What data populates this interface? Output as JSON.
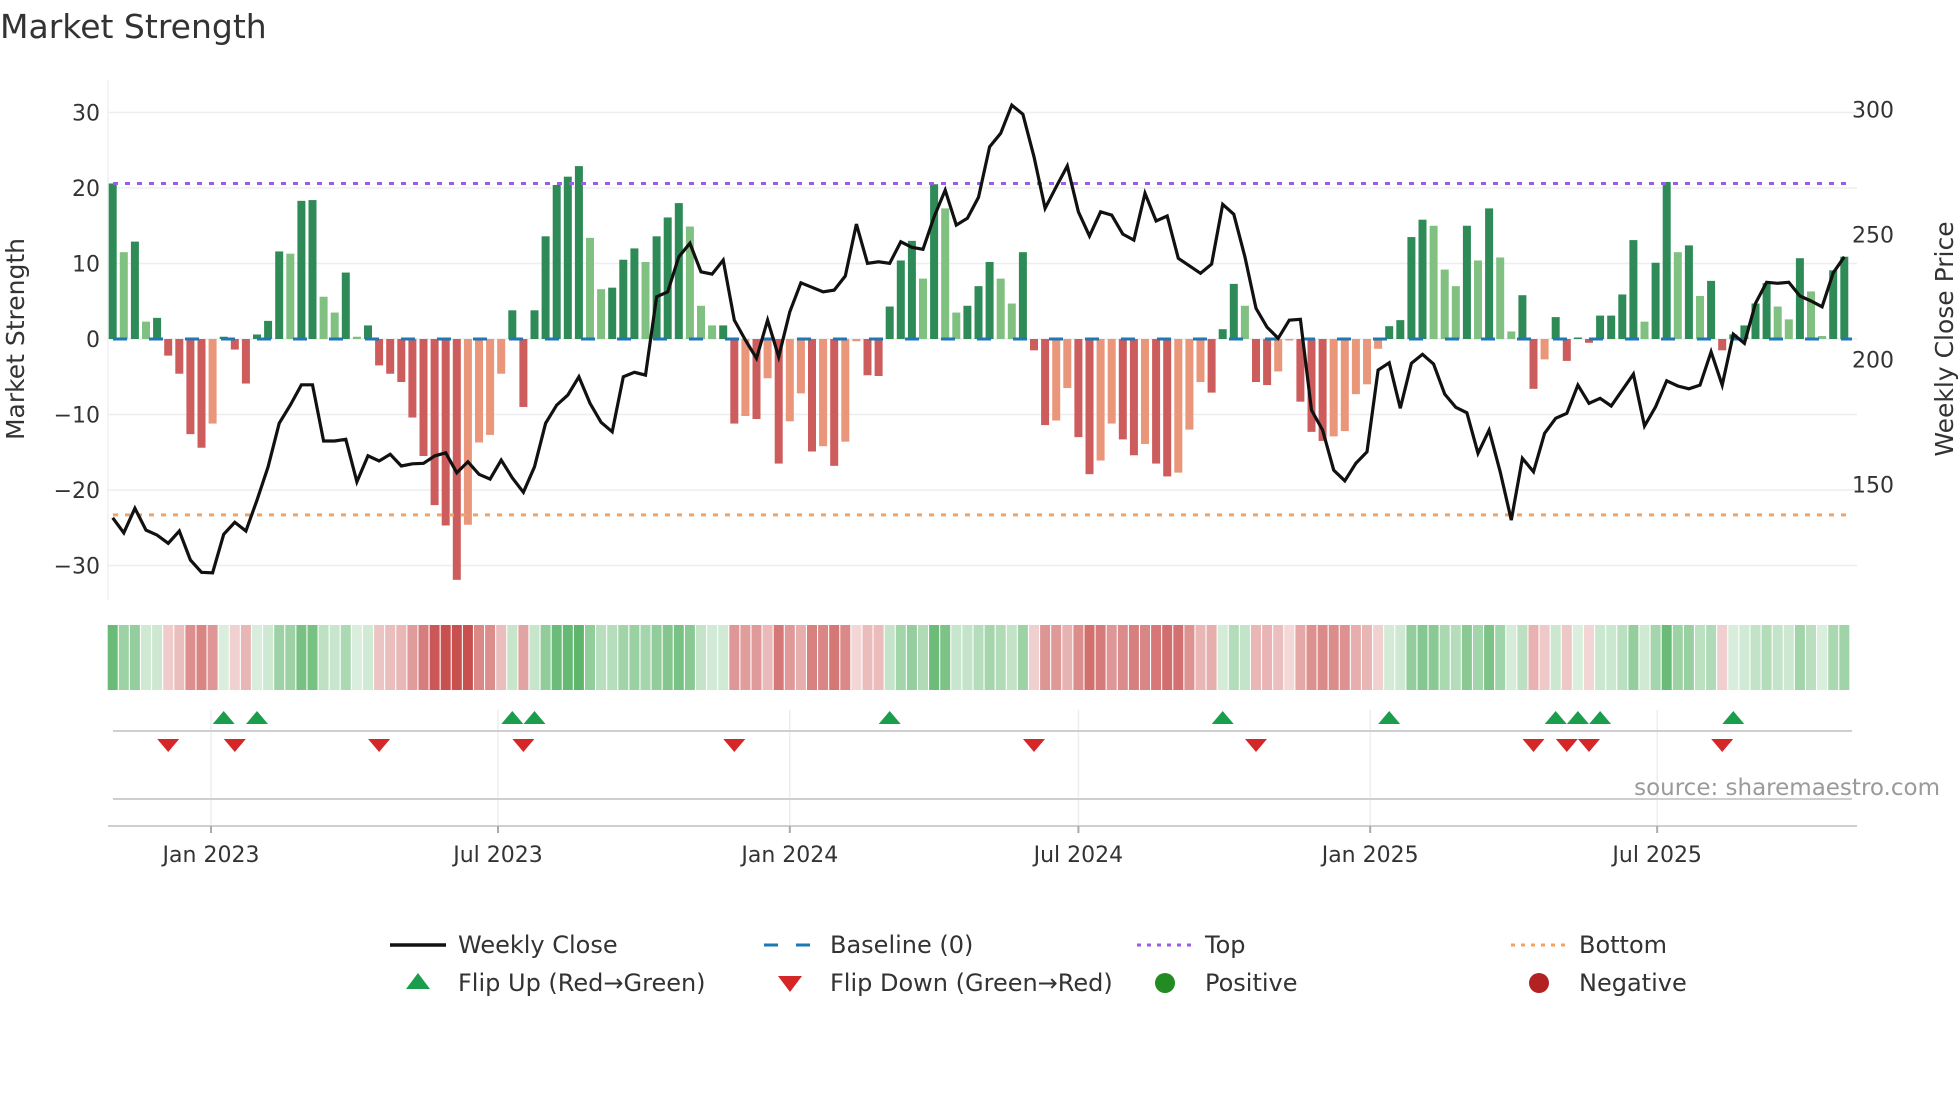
{
  "chart_data": {
    "type": "bar",
    "title": "Market Strength",
    "ylabel": "Market Strength",
    "y2label": "Weekly Close Price",
    "ylim": [
      -35,
      34
    ],
    "y2lim": [
      113,
      304
    ],
    "yticks": [
      30,
      20,
      10,
      0,
      -10,
      -20,
      -30
    ],
    "yticklabels": [
      "30",
      "20",
      "10",
      "0",
      "−10",
      "−20",
      "−30"
    ],
    "y2ticks": [
      300,
      250,
      200,
      150
    ],
    "y2ticklabels": [
      "300",
      "250",
      "200",
      "150"
    ],
    "start_week": "2022-10-31",
    "frequency": "weekly",
    "xticks": [
      {
        "date": "2023-01-01",
        "label": "Jan 2023"
      },
      {
        "date": "2023-07-01",
        "label": "Jul 2023"
      },
      {
        "date": "2024-01-01",
        "label": "Jan 2024"
      },
      {
        "date": "2024-07-01",
        "label": "Jul 2024"
      },
      {
        "date": "2025-01-01",
        "label": "Jan 2025"
      },
      {
        "date": "2025-07-01",
        "label": "Jul 2025"
      }
    ],
    "top_level": 20.6,
    "bottom_level": -23.3,
    "baseline": 0,
    "series": [
      {
        "name": "Market Strength",
        "type": "bar",
        "axis": "left",
        "values": [
          20.6,
          11.5,
          12.9,
          2.3,
          2.8,
          -2.2,
          -4.6,
          -12.6,
          -14.4,
          -11.2,
          0.3,
          -1.4,
          -5.9,
          0.6,
          2.4,
          11.6,
          11.3,
          18.3,
          18.4,
          5.6,
          3.5,
          8.8,
          0.3,
          1.8,
          -3.5,
          -4.6,
          -5.7,
          -10.4,
          -15.5,
          -22,
          -24.7,
          -31.9,
          -24.6,
          -13.7,
          -12.7,
          -4.6,
          3.8,
          -9,
          3.8,
          13.6,
          20.4,
          21.5,
          22.9,
          13.4,
          6.6,
          6.8,
          10.5,
          12,
          10.2,
          13.6,
          16.1,
          18,
          14.9,
          4.4,
          1.8,
          1.8,
          -11.2,
          -10.2,
          -10.6,
          -5.2,
          -16.5,
          -10.9,
          -7.2,
          -14.9,
          -14.2,
          -16.8,
          -13.6,
          -0.3,
          -4.8,
          -4.9,
          4.3,
          10.4,
          13,
          8,
          20.5,
          17.3,
          3.5,
          4.4,
          7,
          10.2,
          8,
          4.7,
          11.5,
          -1.5,
          -11.4,
          -10.8,
          -6.5,
          -13,
          -17.9,
          -16.1,
          -11.2,
          -13.3,
          -15.4,
          -13.9,
          -16.5,
          -18.2,
          -17.7,
          -12,
          -5.7,
          -7.1,
          1.3,
          7.3,
          4.4,
          -5.7,
          -6.1,
          -4.3,
          -0.1,
          -8.3,
          -12.3,
          -13.5,
          -12.9,
          -12.2,
          -7.3,
          -6,
          -1.3,
          1.7,
          2.5,
          13.5,
          15.8,
          15,
          9.2,
          7,
          15,
          10.4,
          17.3,
          10.8,
          1,
          5.8,
          -6.6,
          -2.7,
          2.9,
          -2.9,
          0.2,
          -0.5,
          3.1,
          3.1,
          5.9,
          13.1,
          2.3,
          10.1,
          20.8,
          11.5,
          12.4,
          5.7,
          7.7,
          -1.5,
          0.6,
          1.8,
          4.7,
          7.4,
          4.3,
          2.6,
          10.7,
          6.3,
          0.4,
          9.1,
          10.9
        ]
      },
      {
        "name": "Weekly Close",
        "type": "line",
        "axis": "right",
        "values": [
          136.6,
          130.6,
          140.4,
          131.7,
          129.7,
          126.4,
          131.3,
          119.7,
          114.8,
          114.6,
          130,
          134.8,
          131.3,
          143.7,
          157,
          174.4,
          181.7,
          189.8,
          189.8,
          167.3,
          167.3,
          168,
          151,
          161.4,
          159.3,
          162,
          157.3,
          158.2,
          158.4,
          161.3,
          162.6,
          154.6,
          159,
          154,
          152.1,
          159.7,
          152.6,
          146.8,
          157,
          174.4,
          181.7,
          185.7,
          193,
          182.4,
          174.8,
          171,
          193,
          194.8,
          193.7,
          225,
          227,
          241,
          246.4,
          235,
          234.1,
          239.7,
          215.7,
          207.7,
          200.4,
          215.7,
          201,
          219,
          230.6,
          228.8,
          227,
          227.7,
          233.3,
          254.1,
          238.4,
          239,
          238.4,
          247,
          244.8,
          244,
          257,
          267.7,
          253.7,
          256.4,
          264.8,
          285,
          290.4,
          301.7,
          298,
          281,
          260.4,
          269,
          277.3,
          259,
          249.3,
          259,
          257.7,
          250.1,
          247.7,
          266.4,
          255.3,
          257.3,
          240.4,
          237.4,
          234.4,
          238.1,
          262,
          258,
          241,
          220.4,
          212.8,
          208.4,
          215.7,
          216,
          179.7,
          171.7,
          155.7,
          151.4,
          158.4,
          163,
          195.7,
          198.6,
          180.4,
          198.4,
          202,
          198.1,
          186.1,
          180.8,
          178.6,
          162.4,
          171.7,
          155,
          135.7,
          160.4,
          155,
          170.4,
          176.4,
          178.4,
          189.7,
          182.4,
          184.4,
          181.3,
          187.7,
          194.1,
          173.3,
          181,
          191.4,
          189.3,
          188.2,
          189.7,
          203,
          189.7,
          210.1,
          206.4,
          222.4,
          230.8,
          230.4,
          230.8,
          225.3,
          223.3,
          221,
          234.6,
          241
        ]
      }
    ],
    "flip_up_weeks": [
      11,
      14,
      37,
      39,
      71,
      101,
      116,
      131,
      133,
      135,
      147
    ],
    "flip_down_weeks": [
      6,
      12,
      25,
      38,
      57,
      84,
      104,
      129,
      132,
      134,
      146
    ],
    "legend": {
      "placement": "bottom",
      "items": [
        {
          "label": "Weekly Close",
          "symbol": "solid-line",
          "color": "#111111"
        },
        {
          "label": "Baseline (0)",
          "symbol": "dashed-line",
          "color": "#1f77b4"
        },
        {
          "label": "Top",
          "symbol": "dotted-line",
          "color": "#9b5de5"
        },
        {
          "label": "Bottom",
          "symbol": "dotted-line",
          "color": "#f4a261"
        },
        {
          "label": "Flip Up (Red→Green)",
          "symbol": "triangle-up",
          "color": "#1a9e4b"
        },
        {
          "label": "Flip Down (Green→Red)",
          "symbol": "triangle-down",
          "color": "#d62728"
        },
        {
          "label": "Positive",
          "symbol": "circle",
          "color": "#228b22"
        },
        {
          "label": "Negative",
          "symbol": "circle",
          "color": "#b22222"
        }
      ]
    },
    "source": "source: sharemaestro.com",
    "colors": {
      "up_strong": "#2e8b57",
      "up_weak": "#80c080",
      "down_strong": "#cd5c5c",
      "down_weak": "#e9967a",
      "heat_pos": "#5cb46a",
      "heat_neg": "#c8504e"
    }
  }
}
